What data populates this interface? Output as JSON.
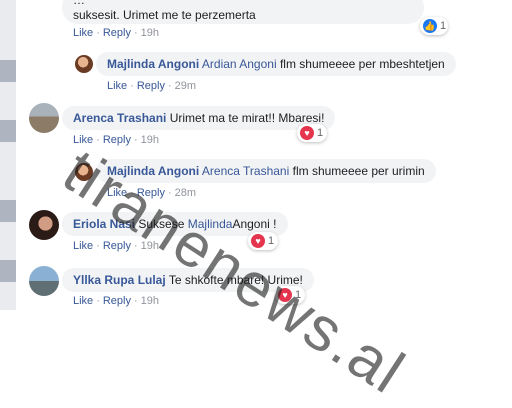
{
  "actions": {
    "like": "Like",
    "reply": "Reply",
    "separator": "·"
  },
  "comments": [
    {
      "text_line1": "…",
      "text_line2": "suksesit. Urimet me te perzemerta",
      "time": "19h",
      "reaction": {
        "icon": "like-icon",
        "count": "1"
      }
    },
    {
      "author": "Majlinda Angoni",
      "tag": "Ardian Angoni",
      "text": "flm shumeeee per mbeshtetjen",
      "time": "29m"
    },
    {
      "author": "Arenca Trashani",
      "text": "Urimet ma te mirat!! Mbaresi!",
      "time": "19h",
      "reaction": {
        "icon": "love-icon",
        "count": "1"
      }
    },
    {
      "author": "Majlinda Angoni",
      "tag": "Arenca Trashani",
      "text": "flm shumeeee per urimin",
      "time": "28m"
    },
    {
      "author": "Eriola Nasi",
      "text_pre": "Suksese",
      "tag": "Majlinda",
      "text_post": "Angoni !",
      "time": "19h",
      "reaction": {
        "icon": "love-icon",
        "count": "1"
      }
    },
    {
      "author": "Yllka Rupa Lulaj",
      "text": "Te shkofte mbare! Urime!",
      "time": "19h",
      "reaction": {
        "icon": "love-icon",
        "count": "1"
      }
    }
  ],
  "watermark": "tiranenews.al",
  "colors": {
    "link": "#385898",
    "bubble": "#f2f3f5",
    "like": "#1877f2",
    "love": "#e5354e"
  }
}
